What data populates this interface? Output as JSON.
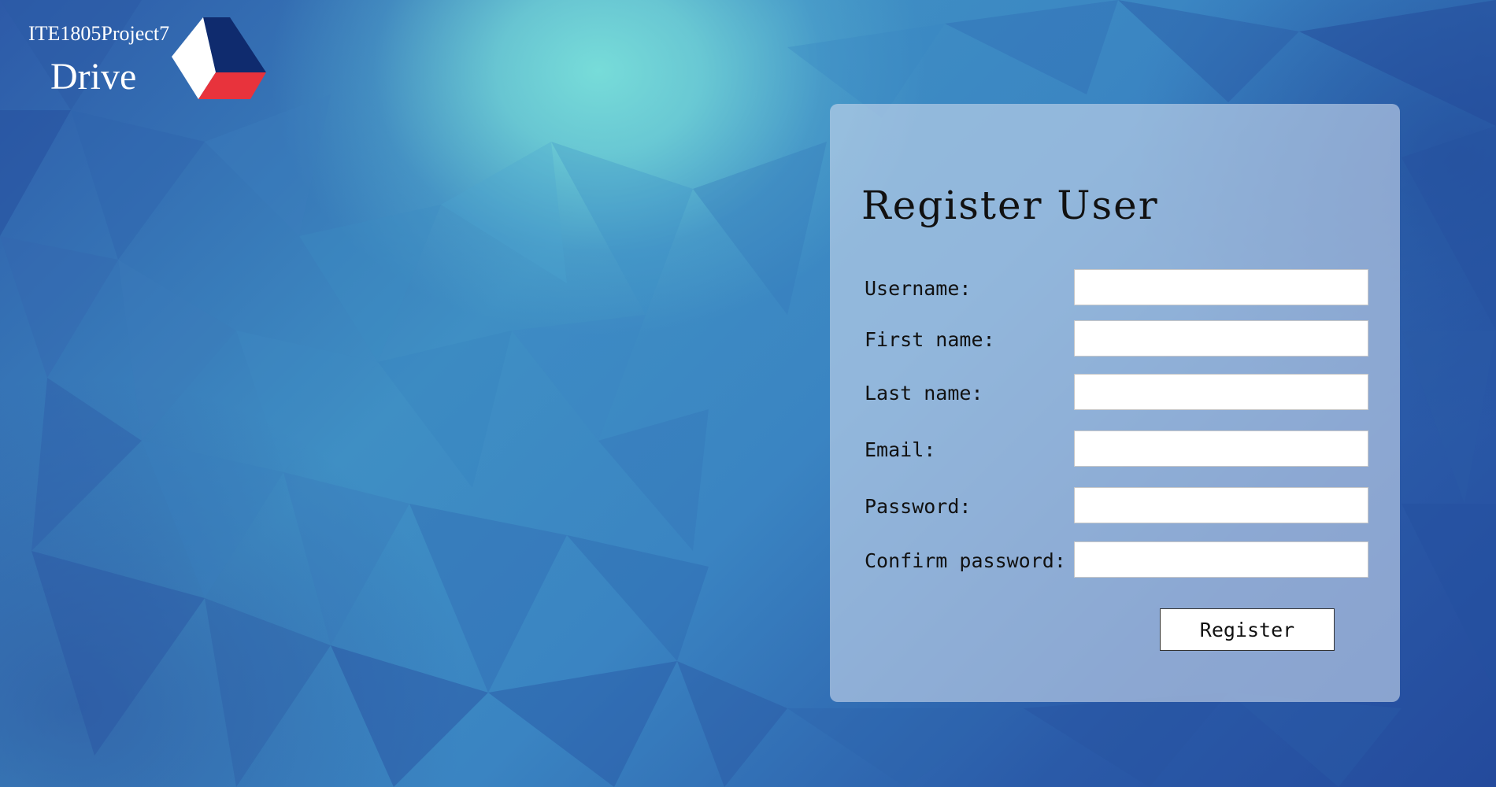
{
  "brand": {
    "project_name": "ITE1805Project7",
    "product_name": "Drive",
    "logo_icon": "tricolor-triangle-logo-icon",
    "logo_colors": {
      "navy": "#0f2b6e",
      "red": "#e8333c",
      "white": "#ffffff"
    }
  },
  "form": {
    "title": "Register User",
    "fields": [
      {
        "label": "Username:",
        "value": "",
        "type": "text"
      },
      {
        "label": "First name:",
        "value": "",
        "type": "text"
      },
      {
        "label": "Last name:",
        "value": "",
        "type": "text"
      },
      {
        "label": "Email:",
        "value": "",
        "type": "email"
      },
      {
        "label": "Password:",
        "value": "",
        "type": "password"
      },
      {
        "label": "Confirm password:",
        "value": "",
        "type": "password"
      }
    ],
    "submit_label": "Register"
  },
  "colors": {
    "background": "#2f6fb3",
    "panel": "#c8d7eb"
  }
}
